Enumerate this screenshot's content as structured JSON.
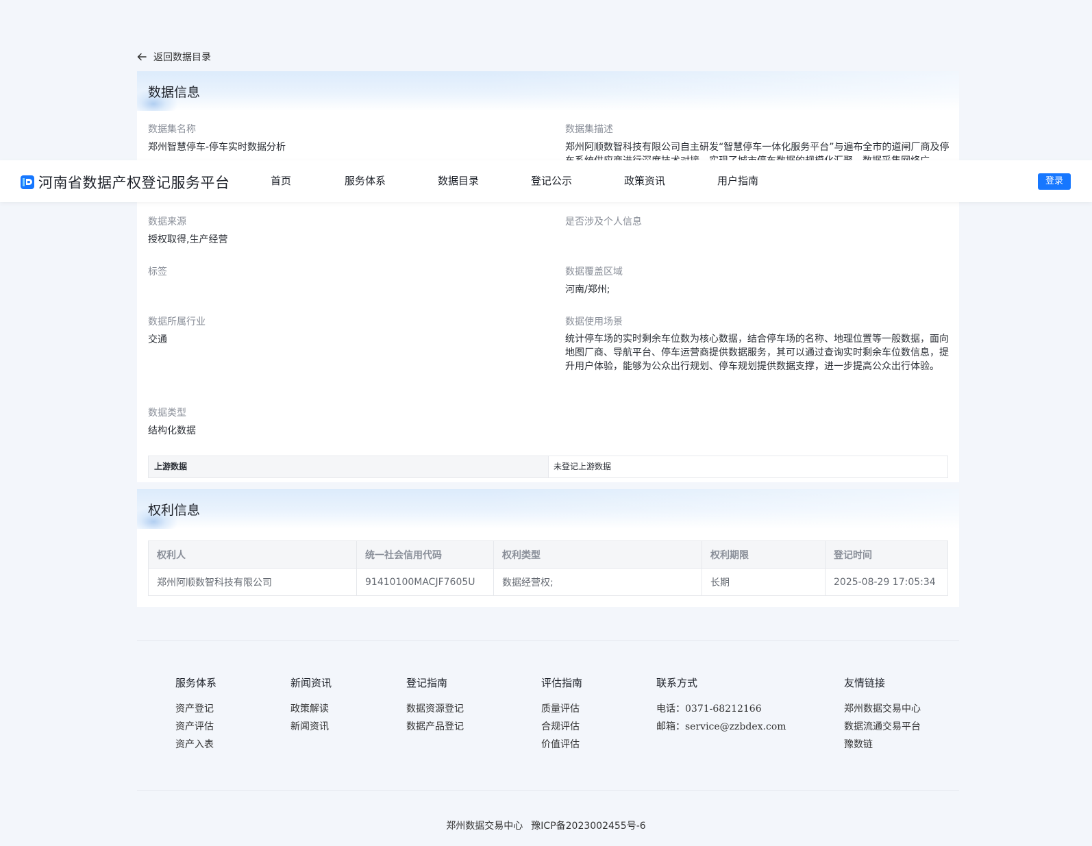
{
  "back": {
    "label": "返回数据目录"
  },
  "header": {
    "brand_name": "河南省数据产权登记服务平台",
    "nav": [
      "首页",
      "服务体系",
      "数据目录",
      "登记公示",
      "政策资讯",
      "用户指南"
    ],
    "login_label": "登录",
    "accent": "#1677ff"
  },
  "data_info": {
    "title": "数据信息",
    "fields": {
      "name": {
        "label": "数据集名称",
        "value": "郑州智慧停车-停车实时数据分析"
      },
      "description": {
        "label": "数据集描述",
        "value": "郑州阿顺数智科技有限公司自主研发“智慧停车一体化服务平台”与遍布全市的道闸厂商及停车系统供应商进行深度技术对接，实现了城市停车数据的规模化汇聚，数据采集网络广"
      },
      "source": {
        "label": "数据来源",
        "value": "授权取得,生产经营"
      },
      "personal_info": {
        "label": "是否涉及个人信息",
        "value": ""
      },
      "tags": {
        "label": "标签",
        "value": ""
      },
      "coverage": {
        "label": "数据覆盖区域",
        "value": "河南/郑州;"
      },
      "industry": {
        "label": "数据所属行业",
        "value": "交通"
      },
      "scenario": {
        "label": "数据使用场景",
        "value": "统计停车场的实时剩余车位数为核心数据，结合停车场的名称、地理位置等一般数据，面向地图厂商、导航平台、停车运营商提供数据服务，其可以通过查询实时剩余车位数信息，提升用户体验，能够为公众出行规划、停车规划提供数据支撑，进一步提高公众出行体验。"
      },
      "type": {
        "label": "数据类型",
        "value": "结构化数据"
      }
    },
    "upstream": {
      "label": "上游数据",
      "value": "未登记上游数据"
    }
  },
  "rights_info": {
    "title": "权利信息",
    "columns": [
      "权利人",
      "统一社会信用代码",
      "权利类型",
      "权利期限",
      "登记时间"
    ],
    "rows": [
      [
        "郑州阿顺数智科技有限公司",
        "91410100MACJF7605U",
        "数据经营权;",
        "长期",
        "2025-08-29 17:05:34"
      ]
    ]
  },
  "footer": {
    "services": {
      "title": "服务体系",
      "links": [
        "资产登记",
        "资产评估",
        "资产入表"
      ]
    },
    "news": {
      "title": "新闻资讯",
      "links": [
        "政策解读",
        "新闻资讯"
      ]
    },
    "registration": {
      "title": "登记指南",
      "links": [
        "数据资源登记",
        "数据产品登记"
      ]
    },
    "evaluation": {
      "title": "评估指南",
      "links": [
        "质量评估",
        "合规评估",
        "价值评估"
      ]
    },
    "contact": {
      "title": "联系方式",
      "phone_label": "电话：",
      "phone": "0371-68212166",
      "email_label": "邮箱：",
      "email": "service@zzbdex.com"
    },
    "friends": {
      "title": "友情链接",
      "links": [
        "郑州数据交易中心",
        "数据流通交易平台",
        "豫数链"
      ]
    },
    "copyright_org": "郑州数据交易中心",
    "icp": "豫ICP备2023002455号-6"
  }
}
